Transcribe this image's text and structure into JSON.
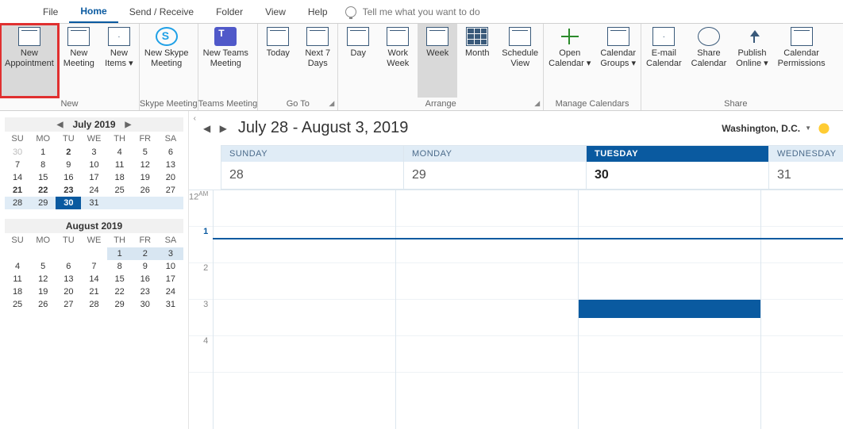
{
  "tabs": {
    "file": "File",
    "home": "Home",
    "sendrecv": "Send / Receive",
    "folder": "Folder",
    "view": "View",
    "help": "Help"
  },
  "tellme_placeholder": "Tell me what you want to do",
  "ribbon": {
    "new": {
      "label": "New",
      "appt": "New\nAppointment",
      "meeting": "New\nMeeting",
      "items": "New\nItems ▾"
    },
    "skype": {
      "label": "Skype Meeting",
      "btn": "New Skype\nMeeting"
    },
    "teams": {
      "label": "Teams Meeting",
      "btn": "New Teams\nMeeting"
    },
    "goto": {
      "label": "Go To",
      "today": "Today",
      "next7": "Next 7\nDays"
    },
    "arrange": {
      "label": "Arrange",
      "day": "Day",
      "work": "Work\nWeek",
      "week": "Week",
      "month": "Month",
      "sched": "Schedule\nView"
    },
    "manage": {
      "label": "Manage Calendars",
      "open": "Open\nCalendar ▾",
      "groups": "Calendar\nGroups ▾"
    },
    "share": {
      "label": "Share",
      "email": "E-mail\nCalendar",
      "sharecal": "Share\nCalendar",
      "publish": "Publish\nOnline ▾",
      "perm": "Calendar\nPermissions"
    }
  },
  "miniCal": {
    "july": {
      "title": "July 2019",
      "dows": [
        "SU",
        "MO",
        "TU",
        "WE",
        "TH",
        "FR",
        "SA"
      ],
      "rows": [
        [
          "30",
          "1",
          "2",
          "3",
          "4",
          "5",
          "6"
        ],
        [
          "7",
          "8",
          "9",
          "10",
          "11",
          "12",
          "13"
        ],
        [
          "14",
          "15",
          "16",
          "17",
          "18",
          "19",
          "20"
        ],
        [
          "21",
          "22",
          "23",
          "24",
          "25",
          "26",
          "27"
        ],
        [
          "28",
          "29",
          "30",
          "31",
          "",
          "",
          ""
        ]
      ]
    },
    "aug": {
      "title": "August 2019",
      "dows": [
        "SU",
        "MO",
        "TU",
        "WE",
        "TH",
        "FR",
        "SA"
      ],
      "rows": [
        [
          "",
          "",
          "",
          "",
          "1",
          "2",
          "3"
        ],
        [
          "4",
          "5",
          "6",
          "7",
          "8",
          "9",
          "10"
        ],
        [
          "11",
          "12",
          "13",
          "14",
          "15",
          "16",
          "17"
        ],
        [
          "18",
          "19",
          "20",
          "21",
          "22",
          "23",
          "24"
        ],
        [
          "25",
          "26",
          "27",
          "28",
          "29",
          "30",
          "31"
        ]
      ]
    }
  },
  "calendar": {
    "range": "July 28 - August 3, 2019",
    "location": "Washington, D.C.",
    "days": [
      {
        "name": "SUNDAY",
        "num": "28"
      },
      {
        "name": "MONDAY",
        "num": "29"
      },
      {
        "name": "TUESDAY",
        "num": "30",
        "today": true
      },
      {
        "name": "WEDNESDAY",
        "num": "31"
      }
    ],
    "hours": [
      "12",
      "1",
      "2",
      "3",
      "4"
    ],
    "ampm": "AM"
  }
}
